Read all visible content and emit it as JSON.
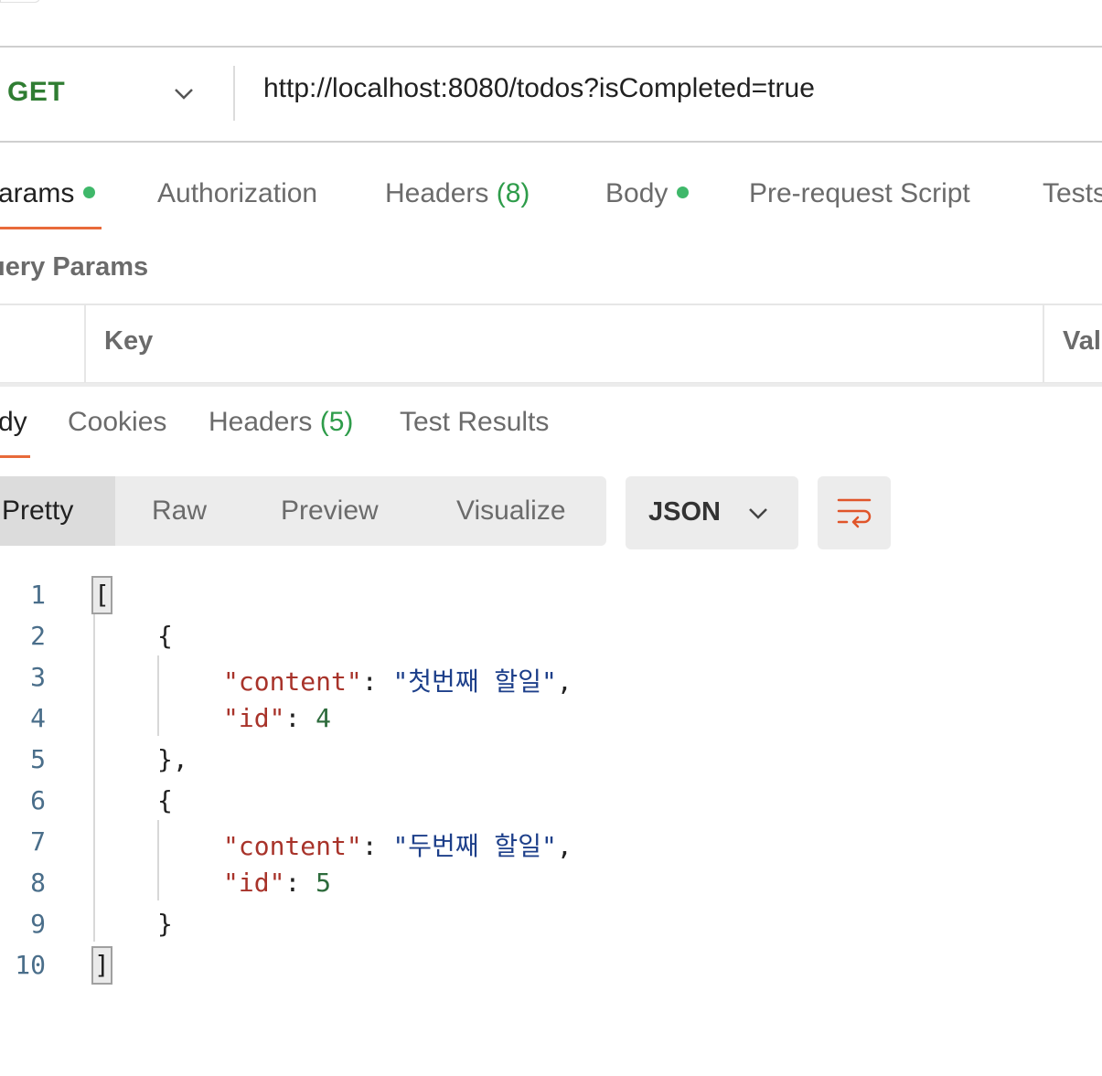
{
  "request": {
    "method": "GET",
    "url": "http://localhost:8080/todos?isCompleted=true"
  },
  "request_tabs": [
    {
      "label": "arams",
      "dot": true
    },
    {
      "label": "Authorization"
    },
    {
      "label": "Headers",
      "count": "(8)"
    },
    {
      "label": "Body",
      "dot": true
    },
    {
      "label": "Pre-request Script"
    },
    {
      "label": "Tests"
    }
  ],
  "params": {
    "title": "uery Params",
    "columns": [
      "Key",
      "Val"
    ]
  },
  "response_tabs": [
    {
      "label": "dy"
    },
    {
      "label": "Cookies"
    },
    {
      "label": "Headers",
      "count": "(5)"
    },
    {
      "label": "Test Results"
    }
  ],
  "view_modes": [
    "Pretty",
    "Raw",
    "Preview",
    "Visualize"
  ],
  "format": "JSON",
  "code": {
    "line_numbers": [
      "1",
      "2",
      "3",
      "4",
      "5",
      "6",
      "7",
      "8",
      "9",
      "10"
    ],
    "open_bracket": "[",
    "close_bracket": "]",
    "open_brace": "{",
    "close_brace_comma": "},",
    "close_brace": "}",
    "key_content": "\"content\"",
    "key_id": "\"id\"",
    "sep": ": ",
    "comma": ",",
    "items": [
      {
        "content": "\"첫번째 할일\"",
        "id": "4"
      },
      {
        "content": "\"두번째 할일\"",
        "id": "5"
      }
    ]
  },
  "icons": [
    "chevron-down-icon",
    "wrap-lines-icon"
  ],
  "colors": {
    "accent": "#e86a3a",
    "method_get": "#2f7d32",
    "dot": "#3fb86a"
  }
}
